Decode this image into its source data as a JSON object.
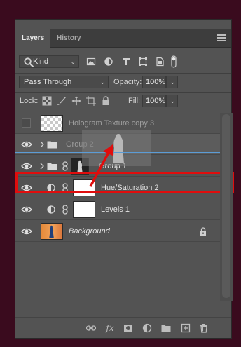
{
  "window": {
    "collapse_glyph": "«",
    "close_glyph": "×"
  },
  "tabs": [
    {
      "label": "Layers",
      "active": true
    },
    {
      "label": "History",
      "active": false
    }
  ],
  "filter": {
    "kind_label": "Kind",
    "icons": [
      "search-icon",
      "image-filter-icon",
      "adjustment-filter-icon",
      "type-filter-icon",
      "shape-filter-icon",
      "smart-object-filter-icon",
      "filter-toggle-icon"
    ]
  },
  "blend": {
    "mode": "Pass Through",
    "opacity_label": "Opacity:",
    "opacity_value": "100%"
  },
  "lock": {
    "label": "Lock:",
    "fill_label": "Fill:",
    "fill_value": "100%"
  },
  "layers": [
    {
      "name": "Hologram Texture copy 3",
      "visible": false,
      "type": "pixel"
    },
    {
      "name": "Group 2",
      "visible": true,
      "type": "group"
    },
    {
      "name": "Group 1",
      "visible": true,
      "type": "group-masked"
    },
    {
      "name": "Hue/Saturation 2",
      "visible": true,
      "type": "adjustment"
    },
    {
      "name": "Levels 1",
      "visible": true,
      "type": "adjustment"
    },
    {
      "name": "Background",
      "visible": true,
      "type": "background",
      "locked": true
    }
  ],
  "bottom_icons": [
    "link-layers-icon",
    "fx-icon",
    "add-mask-icon",
    "new-adjustment-icon",
    "new-group-icon",
    "new-layer-icon",
    "delete-layer-icon"
  ],
  "colors": {
    "highlight": "#e00d0d",
    "accent_blue": "#5b9cd6",
    "backdrop": "#3a0b1e"
  }
}
